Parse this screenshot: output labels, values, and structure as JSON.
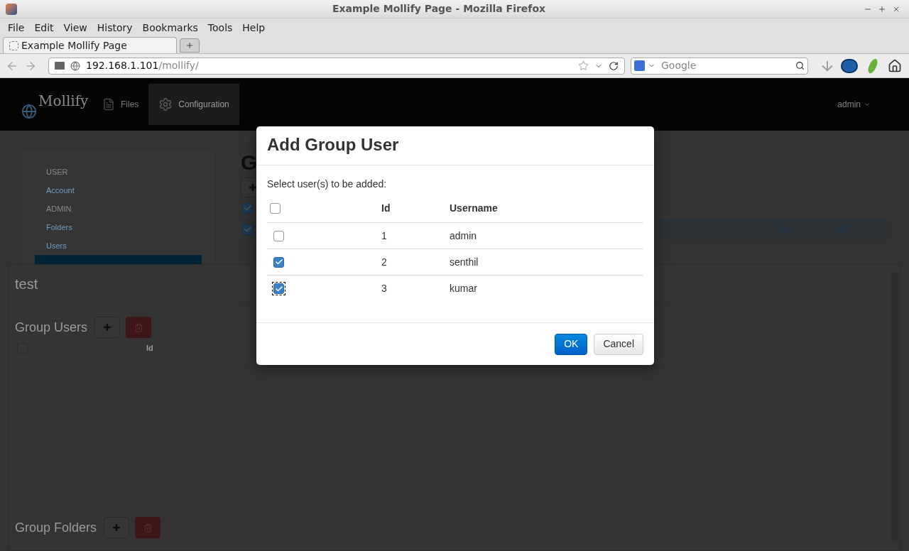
{
  "window": {
    "title": "Example Mollify Page - Mozilla Firefox"
  },
  "menu": [
    "File",
    "Edit",
    "View",
    "History",
    "Bookmarks",
    "Tools",
    "Help"
  ],
  "tabs": [
    {
      "label": "Example Mollify Page",
      "selected": true
    }
  ],
  "address_bar": {
    "host": "192.168.1.101",
    "path": "/mollify/"
  },
  "search": {
    "placeholder": "Google"
  },
  "app": {
    "logo": "Mollify",
    "nav": [
      {
        "label": "Files",
        "selected": false,
        "kind": "file"
      },
      {
        "label": "Configuration",
        "selected": true,
        "kind": "gear"
      }
    ],
    "user_menu": "admin"
  },
  "sidebar": {
    "items": [
      {
        "kind": "header",
        "label": "USER"
      },
      {
        "kind": "link",
        "label": "Account"
      },
      {
        "kind": "header",
        "label": "ADMIN"
      },
      {
        "kind": "link",
        "label": "Folders"
      },
      {
        "kind": "link",
        "label": "Users"
      }
    ]
  },
  "main": {
    "heading": "G",
    "rows": [
      {
        "checked": true,
        "highlighted": false
      },
      {
        "checked": true,
        "highlighted": true
      }
    ]
  },
  "panel": {
    "title": "test",
    "sections": [
      {
        "title": "Group Users",
        "select_all": false,
        "columns": [
          "Id"
        ]
      },
      {
        "title": "Group Folders"
      }
    ]
  },
  "dialog": {
    "title": "Add Group User",
    "prompt": "Select user(s) to be added:",
    "select_all": false,
    "columns": [
      "Id",
      "Username"
    ],
    "rows": [
      {
        "id": "1",
        "username": "admin",
        "checked": false,
        "focused": false
      },
      {
        "id": "2",
        "username": "senthil",
        "checked": true,
        "focused": false
      },
      {
        "id": "3",
        "username": "kumar",
        "checked": true,
        "focused": true
      }
    ],
    "buttons": [
      {
        "label": "OK",
        "kind": "primary"
      },
      {
        "label": "Cancel",
        "kind": "default"
      }
    ]
  }
}
